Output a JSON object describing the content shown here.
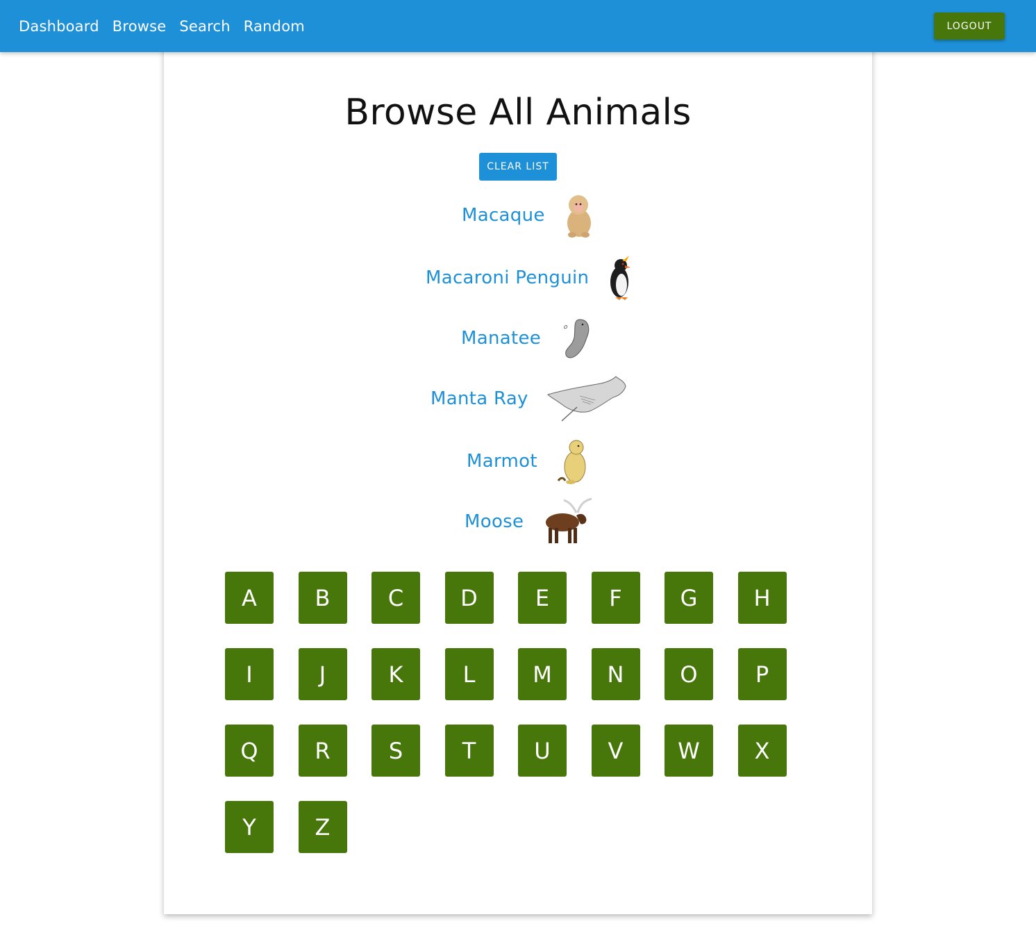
{
  "nav": {
    "links": [
      "Dashboard",
      "Browse",
      "Search",
      "Random"
    ],
    "logout_label": "LOGOUT"
  },
  "page": {
    "title": "Browse All Animals",
    "clear_label": "CLEAR LIST"
  },
  "animals": [
    {
      "name": "Macaque",
      "image": "macaque-illustration"
    },
    {
      "name": "Macaroni Penguin",
      "image": "penguin-illustration"
    },
    {
      "name": "Manatee",
      "image": "manatee-illustration"
    },
    {
      "name": "Manta Ray",
      "image": "manta-ray-illustration"
    },
    {
      "name": "Marmot",
      "image": "marmot-illustration"
    },
    {
      "name": "Moose",
      "image": "moose-illustration"
    }
  ],
  "letters": [
    "A",
    "B",
    "C",
    "D",
    "E",
    "F",
    "G",
    "H",
    "I",
    "J",
    "K",
    "L",
    "M",
    "N",
    "O",
    "P",
    "Q",
    "R",
    "S",
    "T",
    "U",
    "V",
    "W",
    "X",
    "Y",
    "Z"
  ],
  "colors": {
    "primary_blue": "#1e90d8",
    "button_green": "#47760a"
  }
}
